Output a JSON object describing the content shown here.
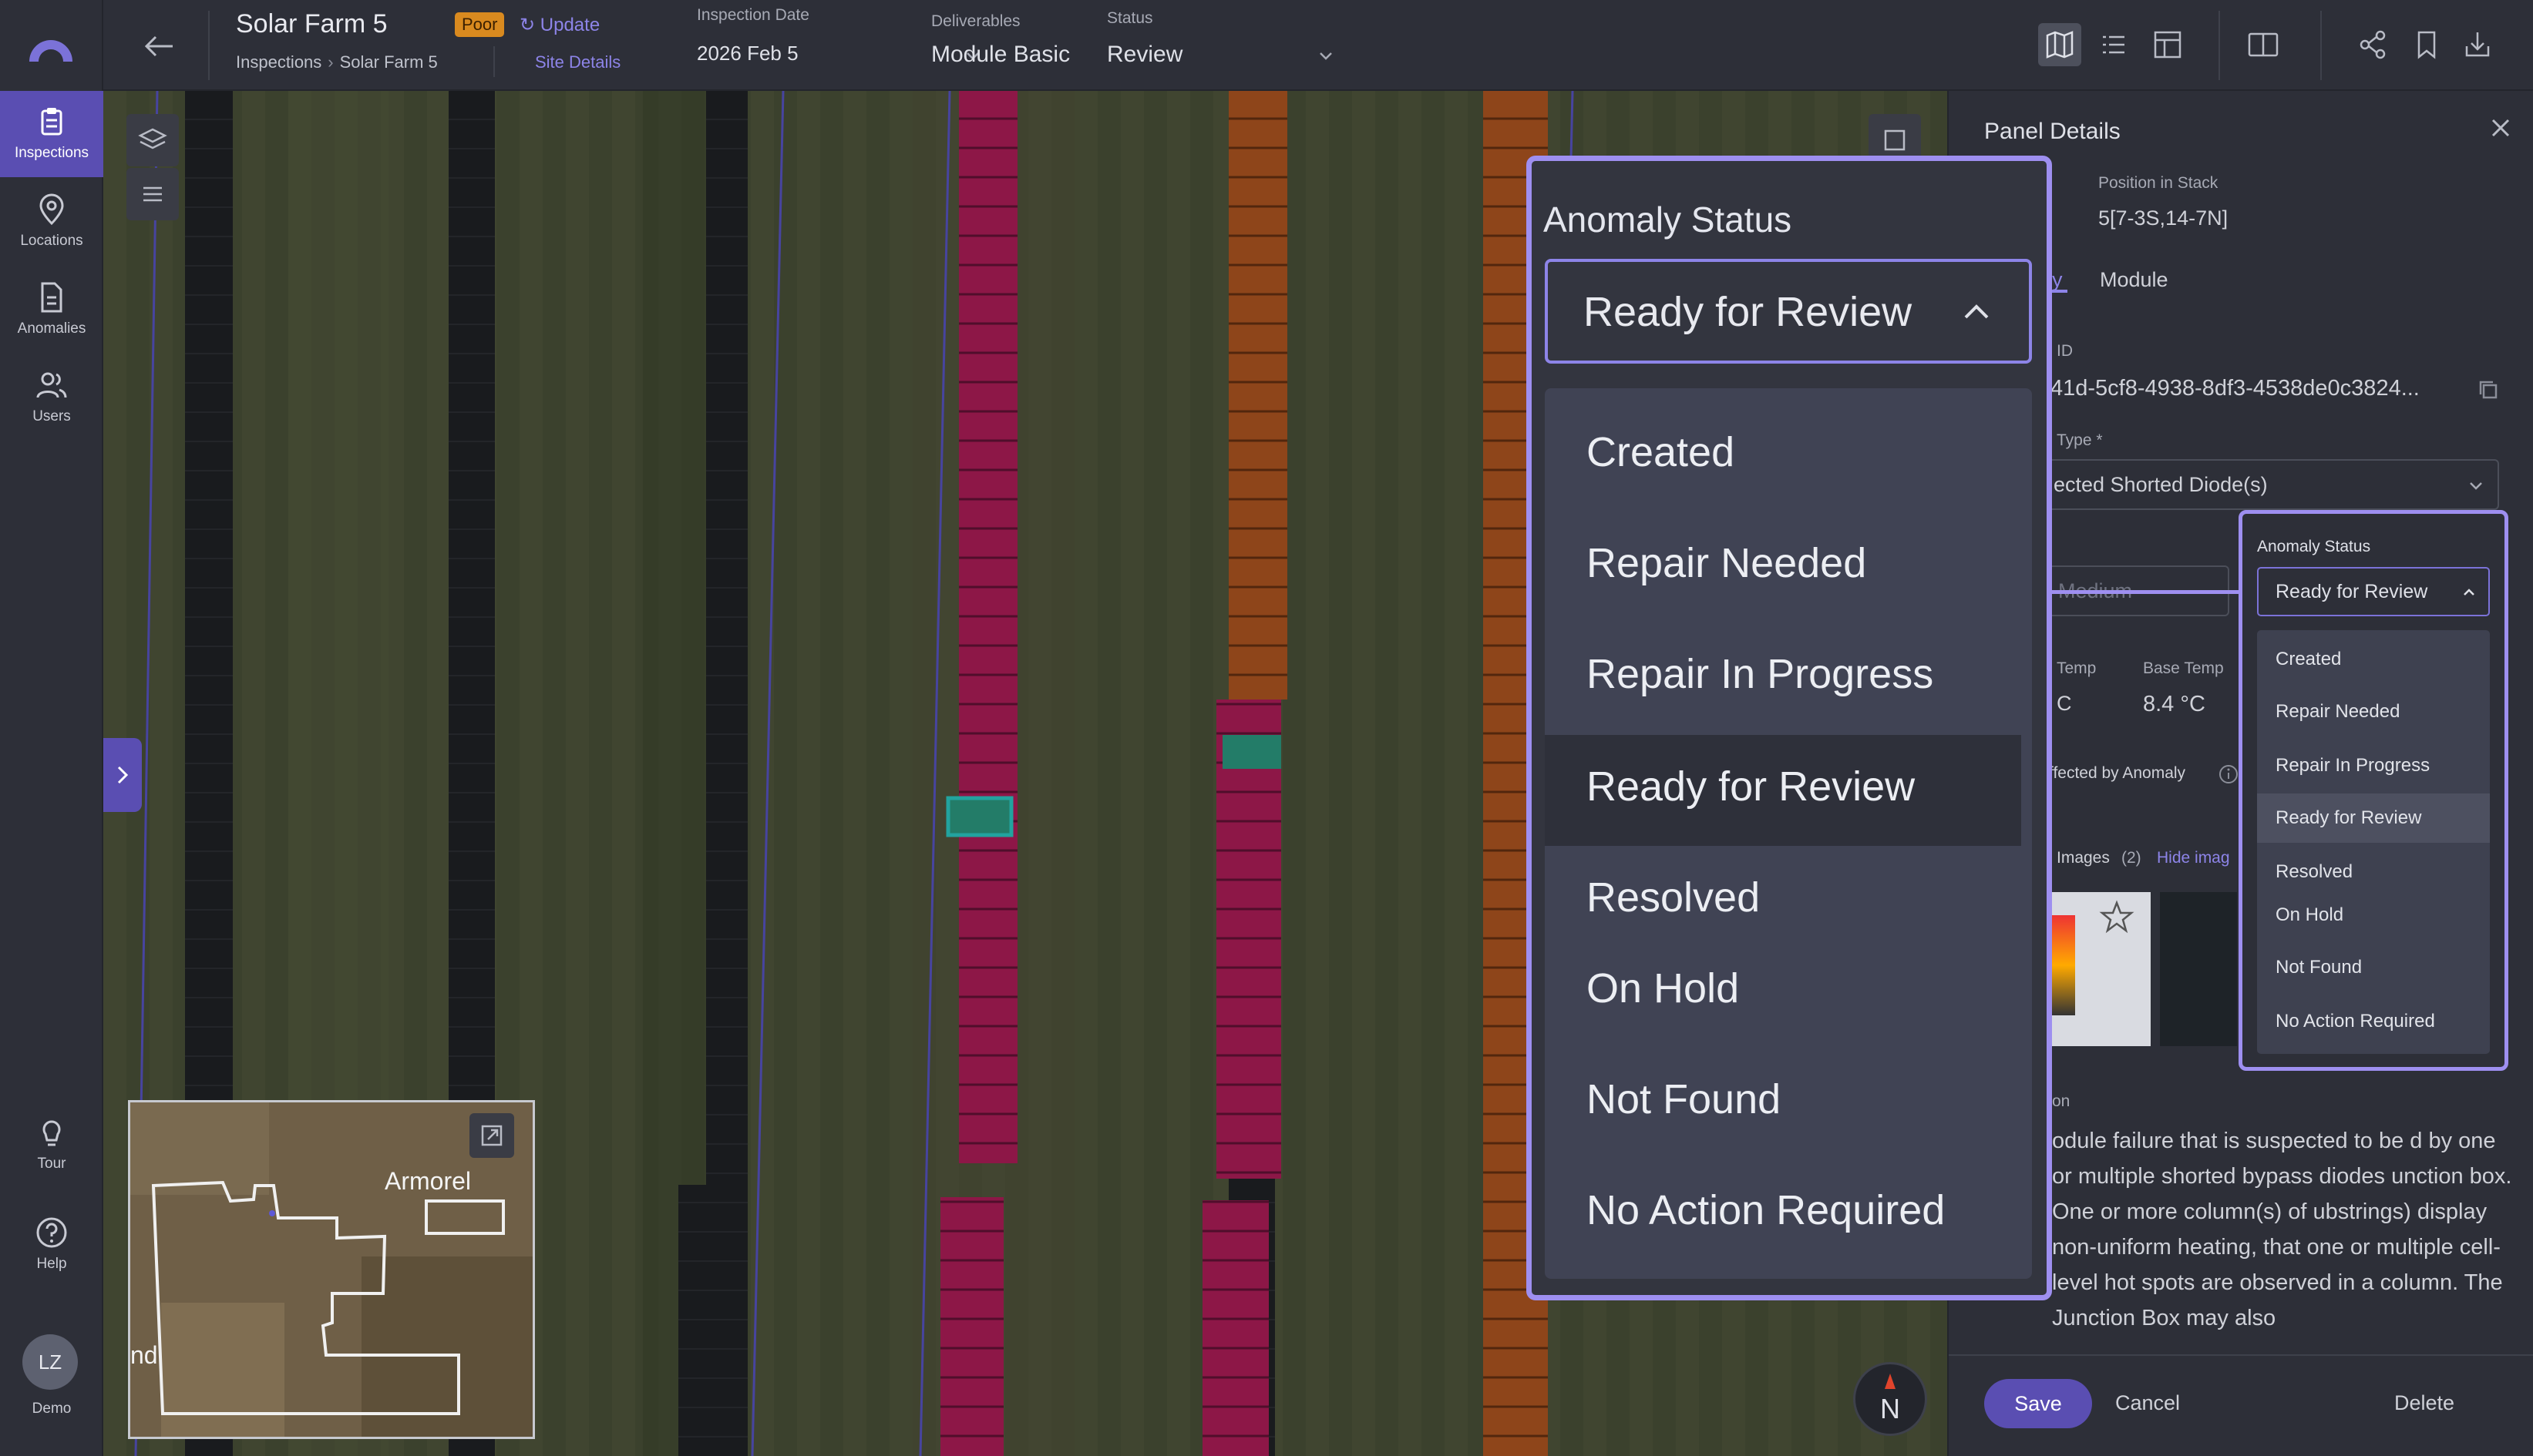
{
  "nav": {
    "items": [
      {
        "label": "Inspections"
      },
      {
        "label": "Locations"
      },
      {
        "label": "Anomalies"
      },
      {
        "label": "Users"
      }
    ],
    "tour": "Tour",
    "help": "Help",
    "user_initials": "LZ",
    "user_name": "Demo"
  },
  "header": {
    "title": "Solar Farm 5",
    "badge": "Poor",
    "update": "Update",
    "breadcrumb": [
      "Inspections",
      "Solar Farm 5"
    ],
    "site_details": "Site Details",
    "inspection_date_label": "Inspection Date",
    "inspection_date": "2026 Feb 5",
    "deliverables_label": "Deliverables",
    "deliverables": "Module Basic",
    "status_label": "Status",
    "status": "Review"
  },
  "map": {
    "minimap_label": "Armorel",
    "minimap_partial": "nd",
    "compass": "N"
  },
  "panel": {
    "title": "Panel Details",
    "position_label": "Position in Stack",
    "position_value": "5[7-3S,14-7N]",
    "tab_partial": "y",
    "tab_module": "Module",
    "id_label": "ID",
    "id_value": "41d-5cf8-4938-8df3-4538de0c3824...",
    "type_label": "Type *",
    "type_value": "ected Shorted Diode(s)",
    "severity_partial": "Medium",
    "temp_label": "Temp",
    "temp_partial": "C",
    "base_temp_label": "Base Temp",
    "base_temp": "8.4 °C",
    "affected": "ffected by Anomaly",
    "images_label": "Images",
    "images_count": "(2)",
    "hide_images": "Hide imag",
    "desc_label": "on",
    "description": "odule failure that is suspected to be d by one or multiple shorted bypass diodes unction box. One or more column(s) of ubstrings) display non-uniform heating, that one or multiple cell-level hot spots are observed in a column. The Junction Box may also",
    "save": "Save",
    "cancel": "Cancel",
    "delete": "Delete"
  },
  "anomaly_status": {
    "label": "Anomaly Status",
    "selected": "Ready for Review",
    "options": [
      "Created",
      "Repair Needed",
      "Repair In Progress",
      "Ready for Review",
      "Resolved",
      "On Hold",
      "Not Found",
      "No Action Required"
    ]
  },
  "colors": {
    "accent": "#5a4eb2",
    "highlight": "#9e8ff0",
    "badge": "#d98a1f",
    "panel_red": "#c2185b",
    "panel_orange": "#c35a1a",
    "panel_selected": "#2aa88a"
  }
}
